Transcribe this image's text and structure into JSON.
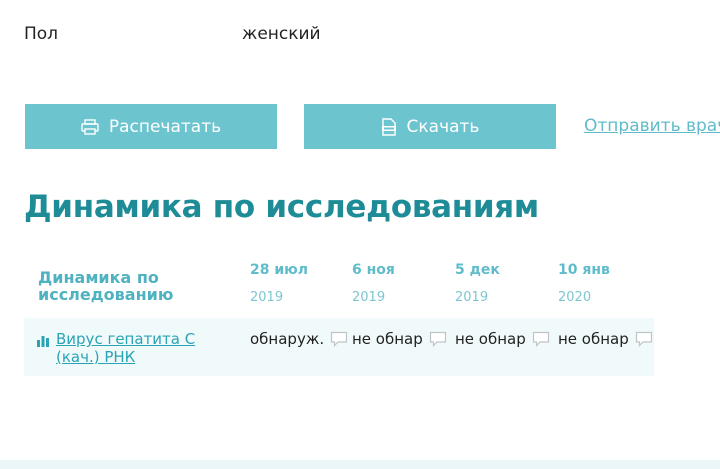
{
  "profile": {
    "gender_label": "Пол",
    "gender_value": "женский"
  },
  "actions": {
    "print_label": "Распечатать",
    "download_label": "Скачать",
    "send_label": "Отправить врачу"
  },
  "section": {
    "title": "Динамика по исследованиям"
  },
  "table": {
    "header_label": "Динамика по исследованию",
    "dates": [
      {
        "day": "28 июл",
        "year": "2019"
      },
      {
        "day": "6 ноя",
        "year": "2019"
      },
      {
        "day": "5 дек",
        "year": "2019"
      },
      {
        "day": "10 янв",
        "year": "2020"
      }
    ],
    "rows": [
      {
        "name": "Вирус гепатита С (кач.) РНК",
        "values": [
          "обнаруж.",
          "не обнар",
          "не обнар",
          "не обнар"
        ]
      }
    ]
  },
  "icons": {
    "print": "printer-icon",
    "download": "document-download-icon",
    "chart": "bar-chart-icon",
    "comment": "speech-bubble-icon"
  },
  "colors": {
    "button_bg": "#6cc4cf",
    "title": "#1e8c96",
    "link": "#5fbcca",
    "row_bg": "#f1fafb"
  }
}
